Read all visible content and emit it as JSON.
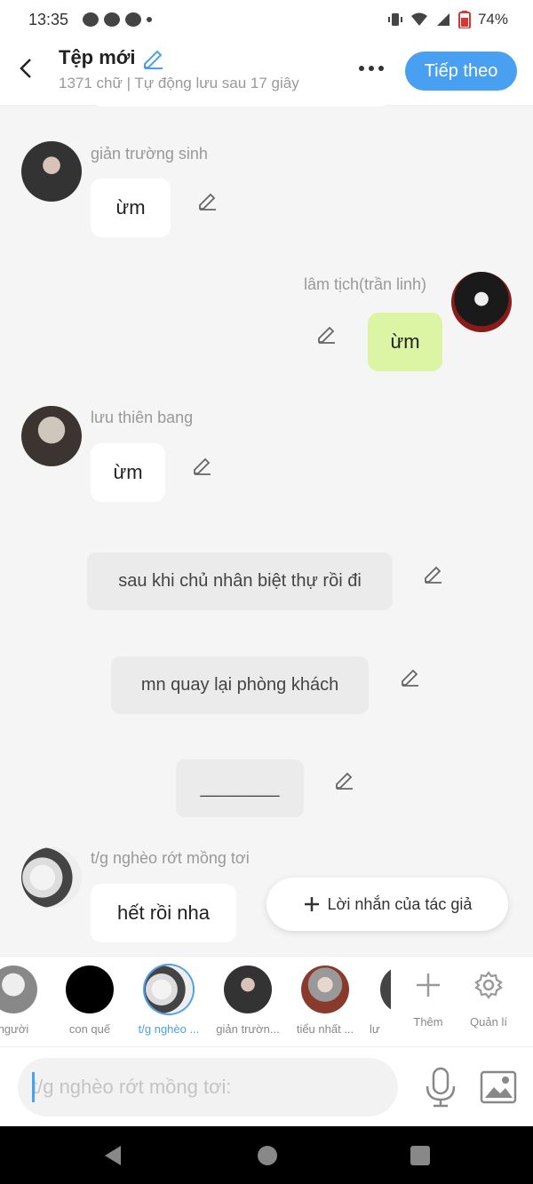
{
  "status": {
    "time": "13:35",
    "battery": "74%"
  },
  "header": {
    "title": "Tệp mới",
    "subtitle": "1371 chữ | Tự động lưu sau 17 giây",
    "next_label": "Tiếp theo"
  },
  "messages": [
    {
      "name": "giản trường sinh",
      "text": "ừm",
      "side": "left"
    },
    {
      "name": "lâm tịch(trần linh)",
      "text": "ừm",
      "side": "right"
    },
    {
      "name": "lưu thiên bang",
      "text": "ừm",
      "side": "left"
    },
    {
      "text": "sau khi chủ nhân biệt thự rồi đi",
      "side": "narration"
    },
    {
      "text": "mn quay lại phòng khách",
      "side": "narration"
    },
    {
      "text": "________",
      "side": "narration"
    },
    {
      "name": "t/g nghèo rớt mồng tơi",
      "text": "hết rồi nha",
      "side": "left"
    }
  ],
  "fab_label": "Lời nhắn của tác giả",
  "characters": [
    {
      "name": "người",
      "color": "#ddd"
    },
    {
      "name": "con quế",
      "color": "#000000"
    },
    {
      "name": "t/g nghèo ...",
      "color": "#e8e8e8",
      "active": true
    },
    {
      "name": "giản trườn...",
      "color": "#555555"
    },
    {
      "name": "tiểu nhất ...",
      "color": "#8a3a2a"
    },
    {
      "name": "lư",
      "color": "#444"
    }
  ],
  "tools": {
    "add_label": "Thêm",
    "manage_label": "Quản lí"
  },
  "input": {
    "placeholder": "t/g nghèo rớt mồng tơi:"
  },
  "colors": {
    "accent": "#4aa0f0",
    "my_bubble": "#dcf5a4"
  }
}
